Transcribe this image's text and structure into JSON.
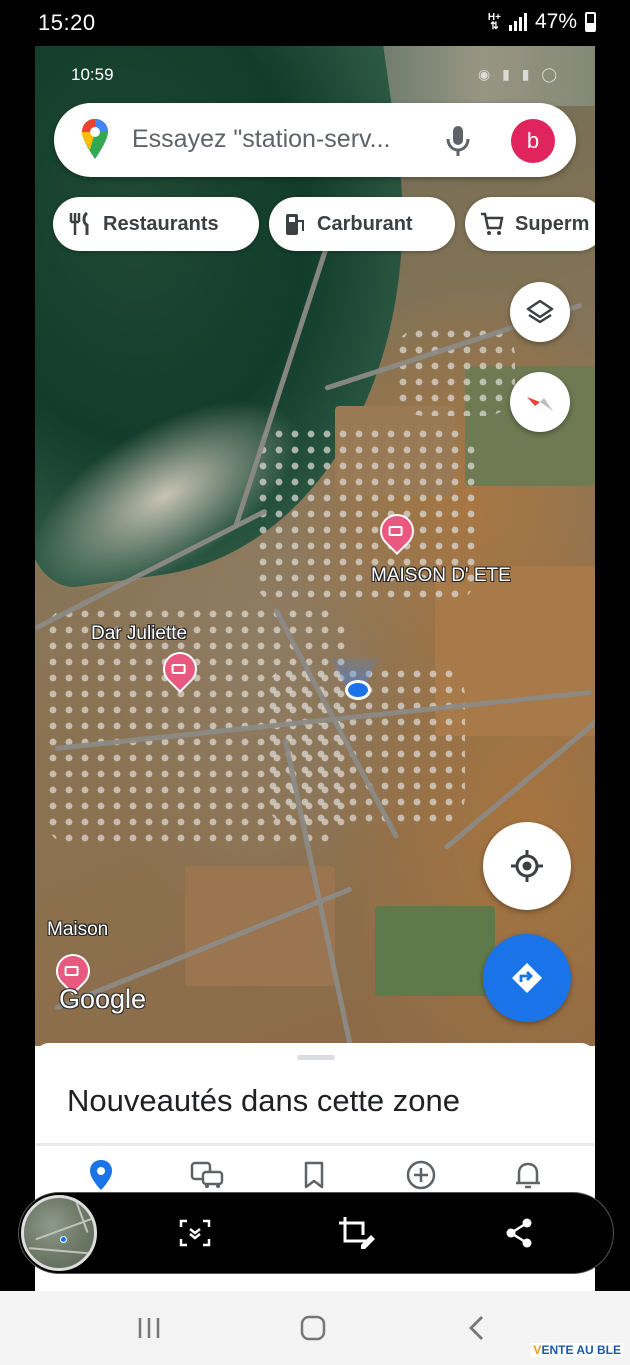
{
  "outer_status": {
    "time": "15:20",
    "network": "H+",
    "battery": "47%"
  },
  "inner_status": {
    "time": "10:59"
  },
  "search": {
    "placeholder": "Essayez \"station-serv...",
    "avatar_letter": "b"
  },
  "chips": [
    {
      "label": "Restaurants",
      "icon": "fork-knife-icon"
    },
    {
      "label": "Carburant",
      "icon": "fuel-pump-icon"
    },
    {
      "label": "Superm",
      "icon": "shopping-cart-icon"
    }
  ],
  "map": {
    "labels": {
      "maison_ete": "MAISON D' ETE",
      "dar_juliette": "Dar Juliette",
      "maison": "Maison"
    },
    "logo": "Google",
    "controls": [
      "layers-icon",
      "compass-icon",
      "my-location-icon",
      "directions-icon"
    ]
  },
  "sheet": {
    "title": "Nouveautés dans cette zone"
  },
  "bottom_nav": [
    "explore-pin-icon",
    "commute-icon",
    "saved-icon",
    "contribute-icon",
    "updates-bell-icon"
  ],
  "capture_toolbar": [
    "scroll-capture-icon",
    "crop-edit-icon",
    "share-icon"
  ],
  "watermark": {
    "prefix": "V",
    "text": "ENTE AU BLE"
  },
  "colors": {
    "accent_blue": "#1a73e8",
    "avatar": "#e0245e",
    "pin": "#e8587f"
  }
}
